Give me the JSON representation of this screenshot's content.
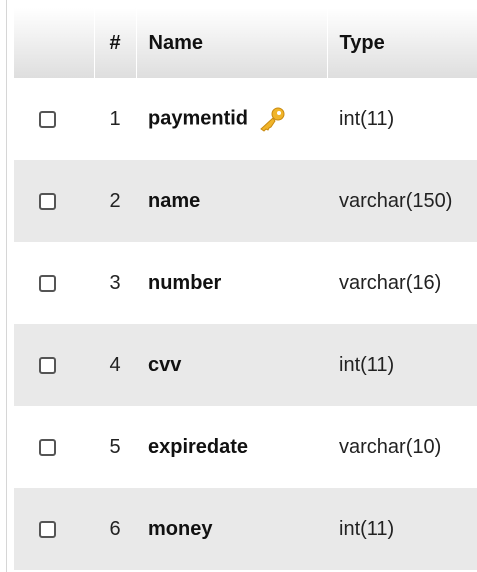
{
  "table": {
    "headers": {
      "index": "#",
      "name": "Name",
      "type": "Type"
    },
    "rows": [
      {
        "index": "1",
        "name": "paymentid",
        "type": "int(11)",
        "primary_key": true
      },
      {
        "index": "2",
        "name": "name",
        "type": "varchar(150)",
        "primary_key": false
      },
      {
        "index": "3",
        "name": "number",
        "type": "varchar(16)",
        "primary_key": false
      },
      {
        "index": "4",
        "name": "cvv",
        "type": "int(11)",
        "primary_key": false
      },
      {
        "index": "5",
        "name": "expiredate",
        "type": "varchar(10)",
        "primary_key": false
      },
      {
        "index": "6",
        "name": "money",
        "type": "int(11)",
        "primary_key": false
      }
    ],
    "icons": {
      "primary_key": "key-icon"
    },
    "colors": {
      "header_top": "#ffffff",
      "header_bottom": "#dedede",
      "row_even": "#e9e9e9",
      "row_odd": "#ffffff",
      "key_icon": "#f0b429"
    }
  }
}
